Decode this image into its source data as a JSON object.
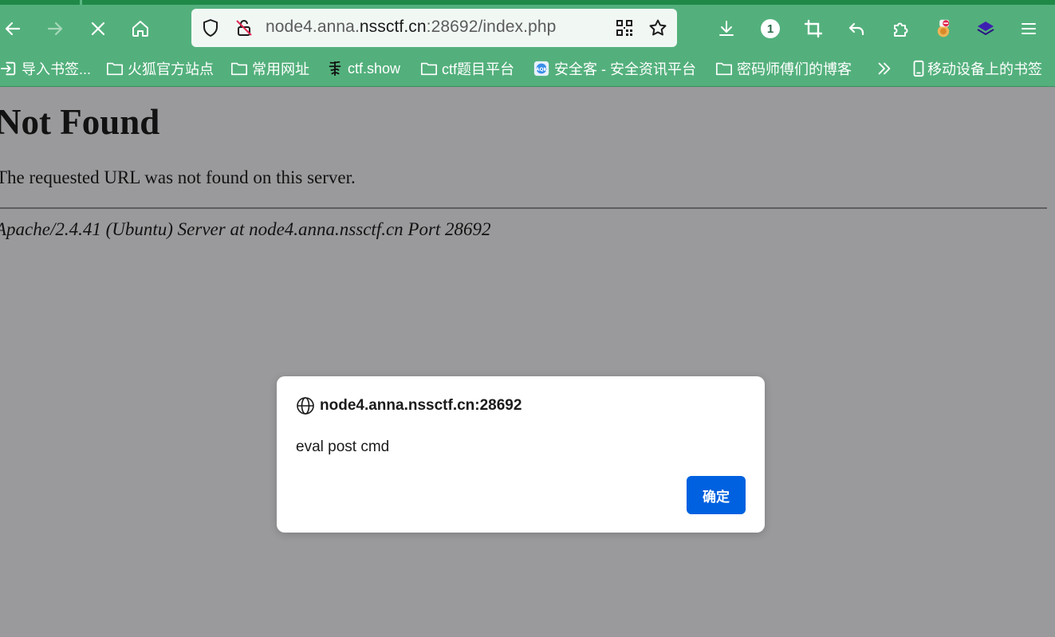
{
  "browser": {
    "url": {
      "prefix": "node4.anna.",
      "host": "nssctf.cn",
      "suffix": ":28692/index.php"
    },
    "toolbar_badge_count": "1",
    "bookmarks": [
      {
        "label": "导入书签...",
        "icon": "import-icon"
      },
      {
        "label": "火狐官方站点",
        "icon": "folder-icon"
      },
      {
        "label": "常用网址",
        "icon": "folder-icon"
      },
      {
        "label": "ctf.show",
        "icon": "ctfshow-icon"
      },
      {
        "label": "ctf题目平台",
        "icon": "folder-icon"
      },
      {
        "label": "安全客 - 安全资讯平台",
        "icon": "anquanke-icon"
      },
      {
        "label": "密码师傅们的博客",
        "icon": "folder-icon"
      },
      {
        "label": "移动设备上的书签",
        "icon": "mobile-icon"
      }
    ]
  },
  "page": {
    "heading": "Not Found",
    "message": "The requested URL was not found on this server.",
    "address": "Apache/2.4.41 (Ubuntu) Server at node4.anna.nssctf.cn Port 28692"
  },
  "dialog": {
    "origin": "node4.anna.nssctf.cn:28692",
    "message": "eval post cmd",
    "ok_label": "确定"
  },
  "colors": {
    "toolbar": "#53b07c",
    "overlay": "#9a9a9c",
    "primary_button": "#0061e0"
  }
}
